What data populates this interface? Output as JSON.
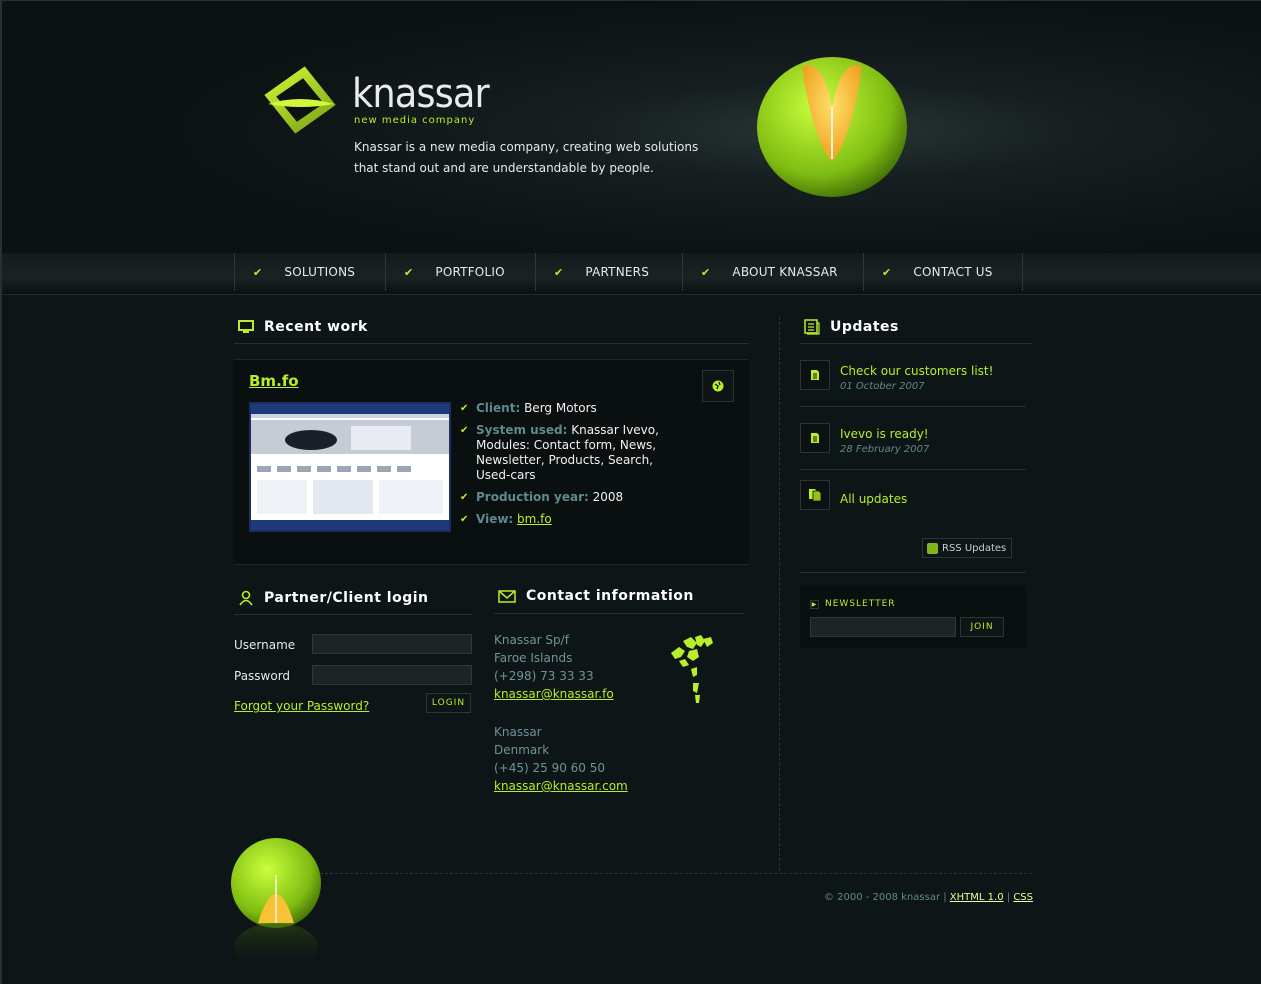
{
  "header": {
    "brand": "knassar",
    "tagline": "new media company",
    "intro": "Knassar is a new media company, creating web solutions that stand out and are understandable by people."
  },
  "nav": {
    "items": [
      {
        "label": "SOLUTIONS"
      },
      {
        "label": "PORTFOLIO"
      },
      {
        "label": "PARTNERS"
      },
      {
        "label": "ABOUT KNASSAR"
      },
      {
        "label": "CONTACT US"
      }
    ]
  },
  "recent_work": {
    "title": "Recent work",
    "project_title": "Bm.fo",
    "client_label": "Client:",
    "client": "Berg Motors",
    "system_label": "System used:",
    "system": "Knassar Ivevo, Modules: Contact form, News, Newsletter, Products, Search, Used-cars",
    "year_label": "Production year:",
    "year": "2008",
    "view_label": "View:",
    "view_link": "bm.fo"
  },
  "login": {
    "title": "Partner/Client login",
    "username_label": "Username",
    "password_label": "Password",
    "forgot": "Forgot your Password?",
    "button": "LOGIN"
  },
  "contact": {
    "title": "Contact information",
    "office1": {
      "line1": "Knassar Sp/f",
      "line2": "Faroe Islands",
      "phone": "(+298) 73 33 33",
      "email": "knassar@knassar.fo"
    },
    "office2": {
      "line1": "Knassar",
      "line2": "Denmark",
      "phone": "(+45) 25 90 60 50",
      "email": "knassar@knassar.com"
    }
  },
  "updates": {
    "title": "Updates",
    "items": [
      {
        "text": "Check our customers list!",
        "date": "01 October 2007"
      },
      {
        "text": "Ivevo is ready!",
        "date": "28 February 2007"
      }
    ],
    "all": "All updates",
    "rss": "RSS Updates"
  },
  "newsletter": {
    "title": "NEWSLETTER",
    "button": "JOIN"
  },
  "footer": {
    "copyright": "© 2000 - 2008 knassar |",
    "xhtml": "XHTML 1.0",
    "sep": "|",
    "css": "CSS"
  },
  "colors": {
    "accent": "#b9ef2a",
    "background": "#0e1516",
    "muted": "#5e8a8d"
  }
}
